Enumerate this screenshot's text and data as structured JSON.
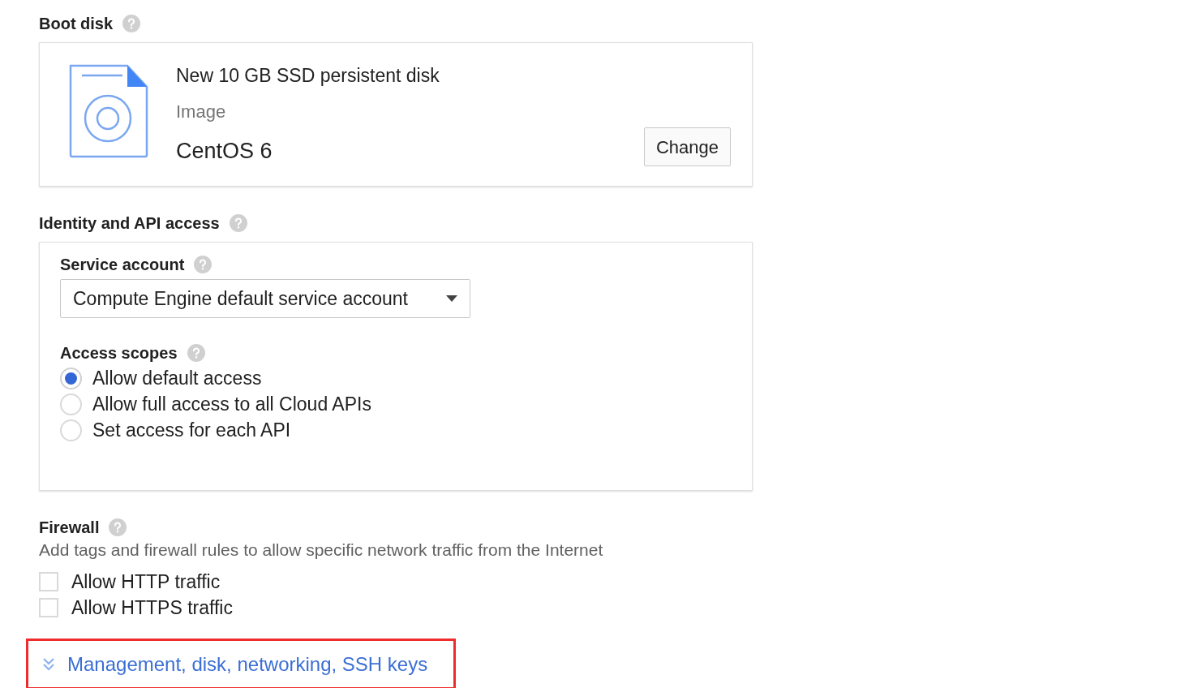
{
  "boot_disk": {
    "heading": "Boot disk",
    "title": "New 10 GB SSD persistent disk",
    "image_label": "Image",
    "image_value": "CentOS 6",
    "button": "Change"
  },
  "identity": {
    "heading": "Identity and API access",
    "service_account": {
      "label": "Service account",
      "value": "Compute Engine default service account"
    },
    "access_scopes": {
      "label": "Access scopes",
      "options": [
        {
          "label": "Allow default access",
          "selected": true
        },
        {
          "label": "Allow full access to all Cloud APIs",
          "selected": false
        },
        {
          "label": "Set access for each API",
          "selected": false
        }
      ]
    }
  },
  "firewall": {
    "heading": "Firewall",
    "description": "Add tags and firewall rules to allow specific network traffic from the Internet",
    "options": [
      {
        "label": "Allow HTTP traffic",
        "checked": false
      },
      {
        "label": "Allow HTTPS traffic",
        "checked": false
      }
    ]
  },
  "more_link": {
    "label": "Management, disk, networking, SSH keys",
    "highlighted": true
  }
}
